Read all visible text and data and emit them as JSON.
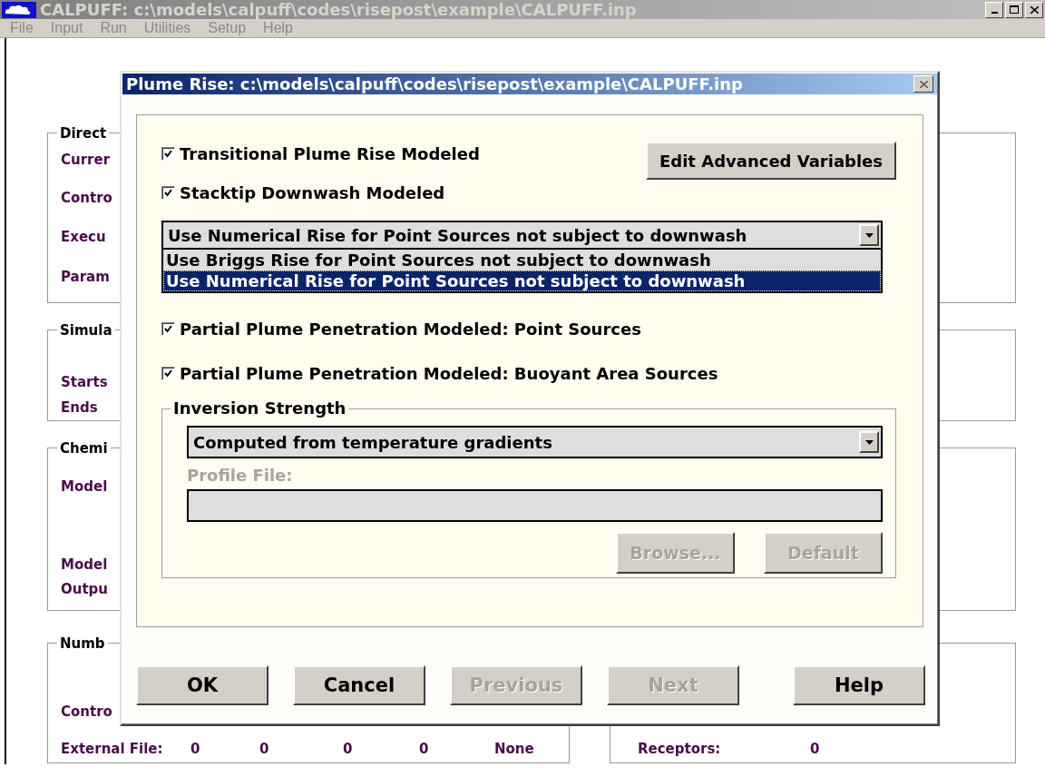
{
  "window": {
    "title": "CALPUFF: c:\\models\\calpuff\\codes\\risepost\\example\\CALPUFF.inp"
  },
  "menu": [
    {
      "label": "File",
      "disabled": true
    },
    {
      "label": "Input",
      "disabled": true
    },
    {
      "label": "Run",
      "disabled": true
    },
    {
      "label": "Utilities",
      "disabled": true
    },
    {
      "label": "Setup",
      "disabled": true
    },
    {
      "label": "Help",
      "disabled": true
    }
  ],
  "left_groups": [
    {
      "title": "Direct",
      "rows": [
        {
          "cells": [
            "Currer"
          ]
        },
        {
          "cells": [
            "Contro"
          ]
        },
        {
          "cells": [
            "Execu"
          ]
        },
        {
          "cells": [
            "Param"
          ]
        }
      ]
    },
    {
      "title": "Simula",
      "rows": [
        {
          "cells": [
            "Starts"
          ]
        },
        {
          "cells": [
            "Ends"
          ]
        }
      ]
    },
    {
      "title": "Chemi",
      "rows": [
        {
          "cells": [
            "Model"
          ]
        },
        {
          "cells": [
            "Model"
          ]
        },
        {
          "cells": [
            "Outpu"
          ]
        }
      ]
    },
    {
      "title": "Numb",
      "rows": [
        {
          "cells": [
            "Contro"
          ]
        },
        {
          "cells": [
            "External File:",
            "0",
            "0",
            "0",
            "0",
            "None"
          ]
        }
      ]
    }
  ],
  "right_group": {
    "rows": [
      {
        "cells": [
          "Receptors:",
          "0"
        ]
      }
    ]
  },
  "dialog": {
    "title": "Plume Rise: c:\\models\\calpuff\\codes\\risepost\\example\\CALPUFF.inp",
    "options_top": [
      {
        "label": "Transitional Plume Rise Modeled",
        "checked": true
      },
      {
        "label": "Stacktip Downwash Modeled",
        "checked": true
      }
    ],
    "advanced_button": "Edit Advanced Variables",
    "rise_method": {
      "value": "Use Numerical Rise for Point Sources not subject to downwash",
      "options": [
        {
          "label": "Use Briggs Rise for Point Sources not subject to downwash",
          "selected": false
        },
        {
          "label": "Use Numerical Rise for Point Sources not subject to downwash",
          "selected": true
        }
      ]
    },
    "options_bottom": [
      {
        "label": "Partial Plume Penetration Modeled: Point Sources",
        "checked": true
      },
      {
        "label": "Partial Plume Penetration Modeled: Buoyant Area Sources",
        "checked": true
      }
    ],
    "inversion": {
      "title": "Inversion Strength",
      "value": "Computed from temperature gradients",
      "profile_label": "Profile File:",
      "profile_disabled": true,
      "buttons": [
        {
          "label": "Browse...",
          "disabled": true
        },
        {
          "label": "Default",
          "disabled": true
        }
      ]
    },
    "buttons": [
      {
        "label": "OK",
        "disabled": false
      },
      {
        "label": "Cancel",
        "disabled": false
      },
      {
        "label": "Previous",
        "disabled": true
      },
      {
        "label": "Next",
        "disabled": true
      },
      {
        "label": "Help",
        "disabled": false
      }
    ]
  }
}
